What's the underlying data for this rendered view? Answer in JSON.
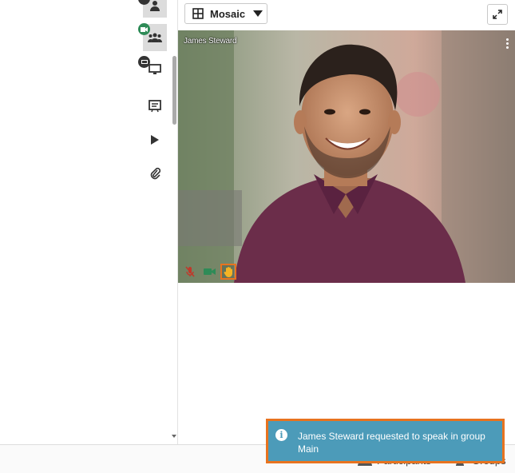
{
  "layout_selector": {
    "label": "Mosaic",
    "icon": "grid-icon"
  },
  "fullscreen": {
    "icon": "fullscreen-icon"
  },
  "video_tile": {
    "participant_name": "James Steward",
    "mic": "mic-off-icon",
    "camera": "camera-on-icon",
    "hand": "raised-hand-icon"
  },
  "sidebar": {
    "items": [
      {
        "icon": "user-icon"
      },
      {
        "icon": "group-icon"
      },
      {
        "icon": "screen-share-icon"
      },
      {
        "icon": "whiteboard-icon"
      },
      {
        "icon": "play-icon"
      },
      {
        "icon": "paperclip-icon"
      }
    ]
  },
  "bottom_bar": {
    "participants_label": "Participants",
    "groups_label": "Groups"
  },
  "toast": {
    "message": "James Steward requested to speak in group Main"
  },
  "colors": {
    "accent_orange": "#e8731f",
    "toast_blue": "#4c9bb9",
    "camera_green": "#2e8b57",
    "mic_red": "#c0392b"
  }
}
